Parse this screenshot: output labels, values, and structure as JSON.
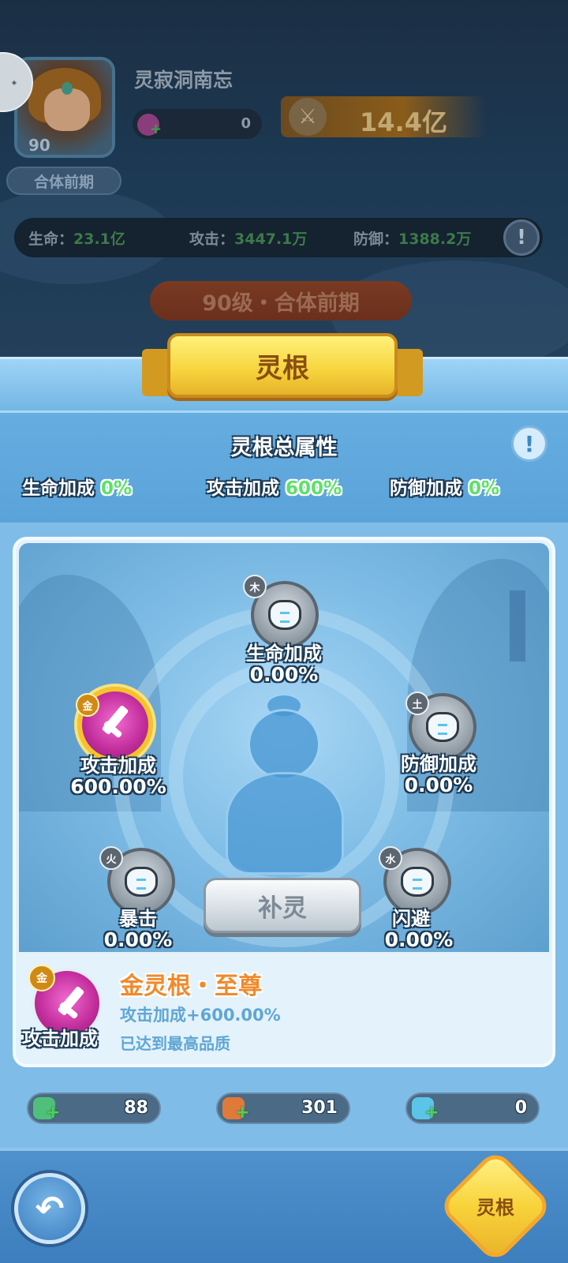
{
  "header": {
    "player_name": "灵寂洞南忘",
    "level": "90",
    "realm": "合体前期",
    "resource_value": "0",
    "power": "14.4亿",
    "stats": {
      "hp_label": "生命：",
      "hp_value": "23.1亿",
      "atk_label": "攻击：",
      "atk_value": "3447.1万",
      "def_label": "防御：",
      "def_value": "1388.2万"
    },
    "level_banner": "90级・合体前期"
  },
  "panel": {
    "title": "灵根",
    "total_title": "灵根总属性",
    "bonuses": [
      {
        "label": "生命加成",
        "value": "0%"
      },
      {
        "label": "攻击加成",
        "value": "600%"
      },
      {
        "label": "防御加成",
        "value": "0%"
      }
    ]
  },
  "nodes": {
    "wood": {
      "element": "木",
      "label": "生命加成",
      "value": "0.00%"
    },
    "metal": {
      "element": "金",
      "label": "攻击加成",
      "value": "600.00%"
    },
    "earth": {
      "element": "土",
      "label": "防御加成",
      "value": "0.00%"
    },
    "fire": {
      "element": "火",
      "label": "暴击",
      "value": "0.00%"
    },
    "water": {
      "element": "水",
      "label": "闪避",
      "value": "0.00%"
    }
  },
  "refill_button": "补灵",
  "detail": {
    "element": "金",
    "label": "攻击加成",
    "name": "金灵根・至尊",
    "bonus": "攻击加成+600.00%",
    "quality": "已达到最高品质"
  },
  "resources": [
    {
      "value": "88",
      "color": "#4fc07a"
    },
    {
      "value": "301",
      "color": "#e07a3a"
    },
    {
      "value": "0",
      "color": "#5cc4e8"
    }
  ],
  "footer": {
    "linggen_button": "灵根"
  },
  "icons": {
    "back": "back-arrow-icon",
    "info": "info-icon",
    "sword": "sword-icon"
  },
  "colors": {
    "green_value": "#5ee06a",
    "gold_title": "#f6d33c",
    "orange_name": "#f08a2c"
  }
}
